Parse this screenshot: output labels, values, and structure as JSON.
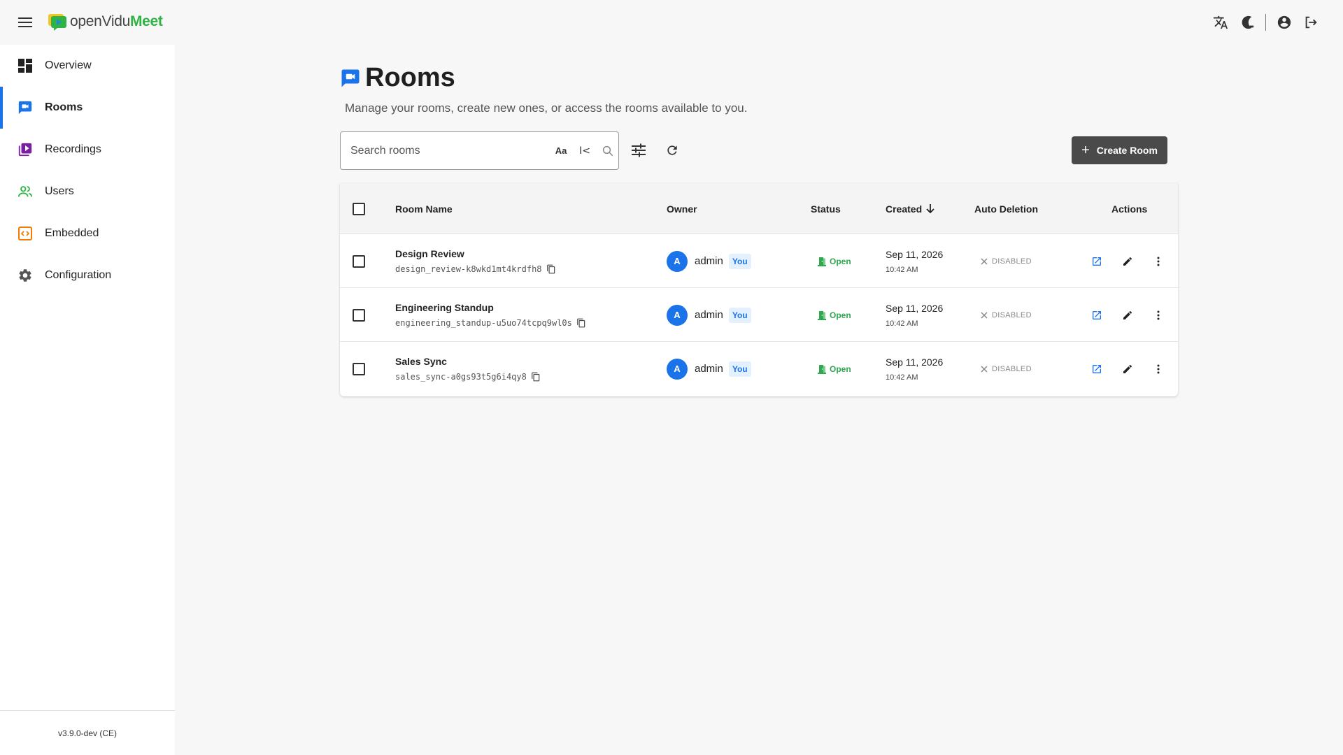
{
  "app": {
    "logo_part1": "openVidu",
    "logo_part2": "Meet",
    "version": "v3.9.0-dev (CE)"
  },
  "topbar": {
    "icons": [
      "translate-icon",
      "theme-toggle-icon",
      "account-icon",
      "logout-icon"
    ]
  },
  "sidebar": {
    "items": [
      {
        "label": "Overview",
        "icon": "dashboard-icon",
        "active": false
      },
      {
        "label": "Rooms",
        "icon": "rooms-icon",
        "active": true
      },
      {
        "label": "Recordings",
        "icon": "recordings-icon",
        "active": false
      },
      {
        "label": "Users",
        "icon": "users-icon",
        "active": false
      },
      {
        "label": "Embedded",
        "icon": "embedded-icon",
        "active": false
      },
      {
        "label": "Configuration",
        "icon": "gear-icon",
        "active": false
      }
    ]
  },
  "page": {
    "title": "Rooms",
    "subtitle": "Manage your rooms, create new ones, or access the rooms available to you."
  },
  "toolbar": {
    "search_placeholder": "Search rooms",
    "match_case_label": "Aa",
    "prefix_label": "I<",
    "create_label": "Create Room"
  },
  "table": {
    "columns": {
      "room_name": "Room Name",
      "owner": "Owner",
      "status": "Status",
      "created": "Created",
      "auto_deletion": "Auto Deletion",
      "actions": "Actions"
    },
    "sort": {
      "column": "created",
      "direction": "desc"
    },
    "rows": [
      {
        "name": "Design Review",
        "id": "design_review-k8wkd1mt4krdfh8",
        "owner_initial": "A",
        "owner": "admin",
        "owner_badge": "You",
        "status": "Open",
        "created_date": "Sep 11, 2026",
        "created_time": "10:42 AM",
        "auto_deletion": "DISABLED"
      },
      {
        "name": "Engineering Standup",
        "id": "engineering_standup-u5uo74tcpq9wl0s",
        "owner_initial": "A",
        "owner": "admin",
        "owner_badge": "You",
        "status": "Open",
        "created_date": "Sep 11, 2026",
        "created_time": "10:42 AM",
        "auto_deletion": "DISABLED"
      },
      {
        "name": "Sales Sync",
        "id": "sales_sync-a0gs93t5g6i4qy8",
        "owner_initial": "A",
        "owner": "admin",
        "owner_badge": "You",
        "status": "Open",
        "created_date": "Sep 11, 2026",
        "created_time": "10:42 AM",
        "auto_deletion": "DISABLED"
      }
    ]
  },
  "colors": {
    "accent": "#1a73e8",
    "open_status": "#2fa84f",
    "create_button": "#4a4a4a",
    "sidebar_bg": "#ffffff",
    "page_bg": "#f7f7f7"
  }
}
